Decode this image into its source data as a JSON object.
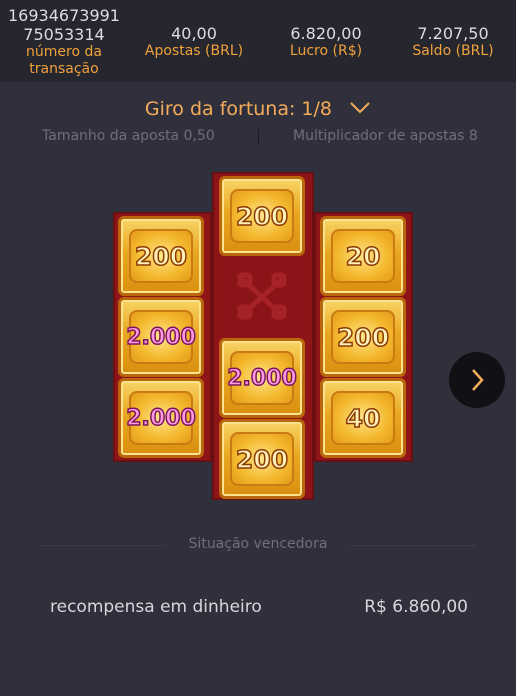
{
  "header": {
    "transaction_line1": "16934673991",
    "transaction_line2": "75053314",
    "transaction_label_line1": "número da",
    "transaction_label_line2": "transação",
    "bets_value": "40,00",
    "bets_label": "Apostas (BRL)",
    "profit_value": "6.820,00",
    "profit_label": "Lucro (R$)",
    "balance_value": "7.207,50",
    "balance_label": "Saldo (BRL)"
  },
  "spin": {
    "title": "Giro da fortuna: 1/8",
    "bet_size": "Tamanho da aposta 0,50",
    "bet_multiplier": "Multiplicador de apostas 8"
  },
  "reels": {
    "left": [
      "200",
      "2.000",
      "2.000"
    ],
    "middle": [
      "200",
      "2.000",
      "200"
    ],
    "right": [
      "20",
      "200",
      "40"
    ]
  },
  "result": {
    "win_label": "Situação vencedora",
    "reward_label": "recompensa em dinheiro",
    "reward_value": "R$ 6.860,00"
  },
  "colors": {
    "accent": "#f0a13a",
    "background": "#30303c",
    "header": "#26262f",
    "reel": "#8f1418"
  },
  "icons": {
    "dropdown": "chevron-down-icon",
    "next": "chevron-right-icon"
  }
}
